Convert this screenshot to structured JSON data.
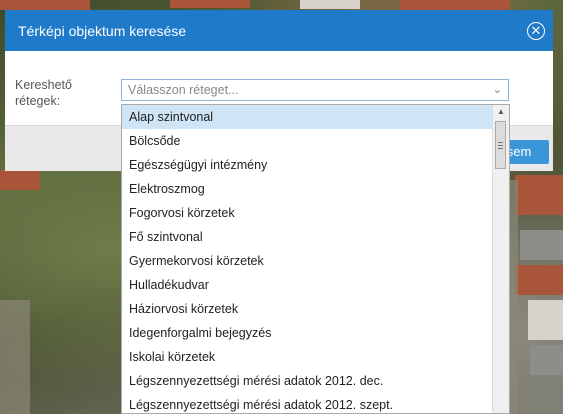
{
  "dialog": {
    "title": "Térképi objektum keresése",
    "close_icon": "close-circle-icon"
  },
  "form": {
    "label": "Kereshető rétegek:",
    "select_placeholder": "Válasszon réteget...",
    "arrow_icon": "chevron-down-icon"
  },
  "footer": {
    "search_button_visible_text": "sem"
  },
  "dropdown": {
    "selected_index": 0,
    "options": [
      "Alap szintvonal",
      "Bölcsőde",
      "Egészségügyi intézmény",
      "Elektroszmog",
      "Fogorvosi körzetek",
      "Fő szintvonal",
      "Gyermekorvosi körzetek",
      "Hulladékudvar",
      "Háziorvosi körzetek",
      "Idegenforgalmi bejegyzés",
      "Iskolai körzetek",
      "Légszennyezettségi mérési adatok 2012. dec.",
      "Légszennyezettségi mérési adatok 2012. szept."
    ]
  },
  "colors": {
    "header": "#1f7bc9",
    "button": "#3a96d9",
    "selected_option": "#cfe4f4"
  }
}
